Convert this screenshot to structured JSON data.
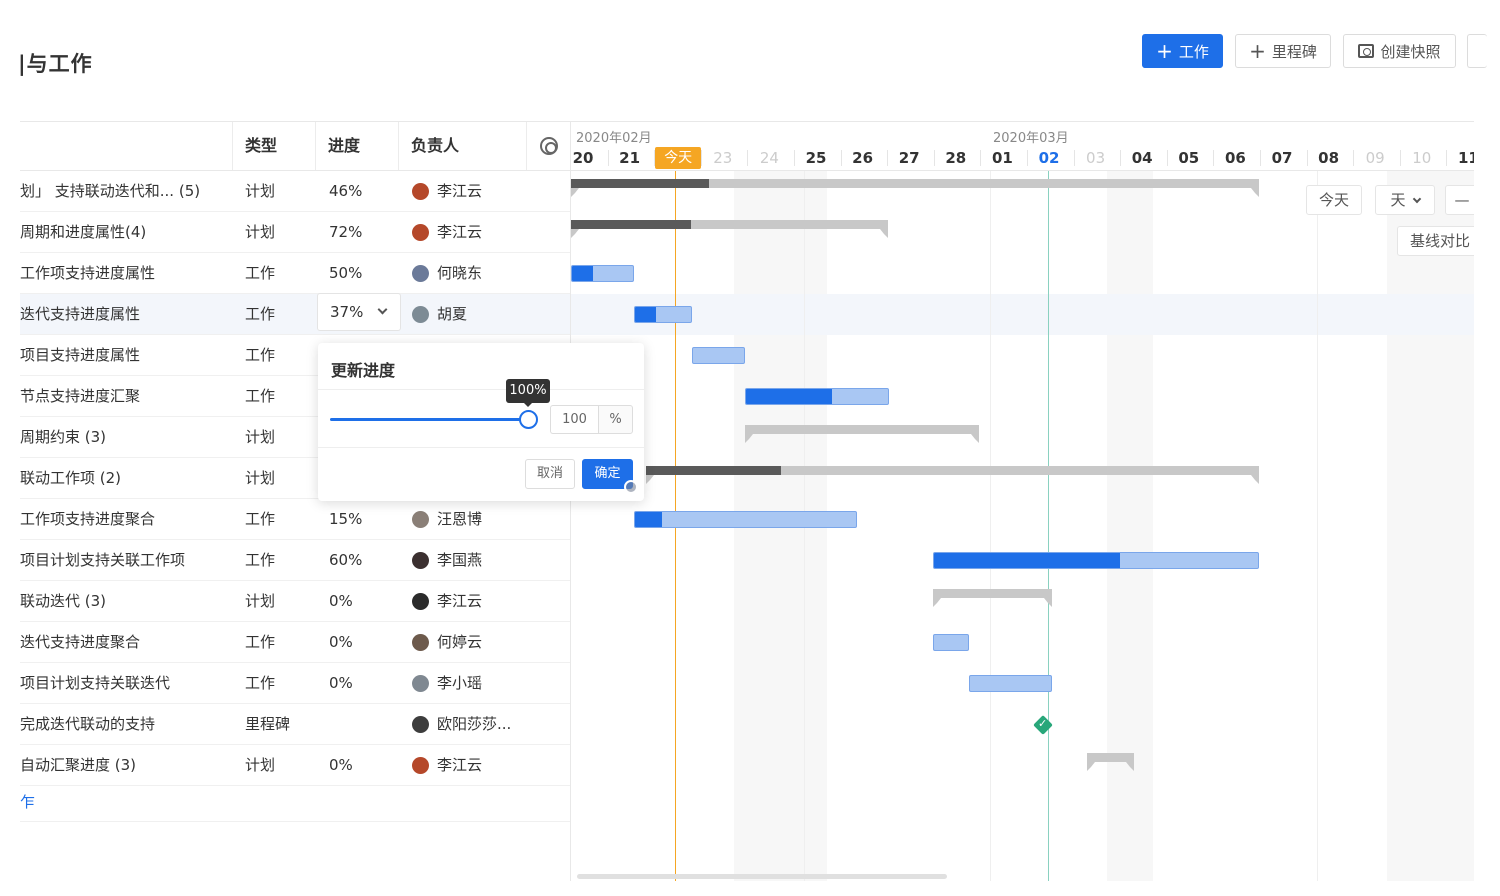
{
  "header": {
    "title": "|与工作",
    "btn_work": "工作",
    "btn_milestone": "里程碑",
    "btn_snapshot": "创建快照"
  },
  "table": {
    "columns": [
      "类型",
      "进度",
      "负责人"
    ],
    "rows": [
      {
        "title": "划」 支持联动迭代和... (5)",
        "type": "计划",
        "progress": "46%",
        "owner": "李江云",
        "avatar": "#b5482a"
      },
      {
        "title": "周期和进度属性(4)",
        "type": "计划",
        "progress": "72%",
        "owner": "李江云",
        "avatar": "#b5482a"
      },
      {
        "title": "工作项支持进度属性",
        "type": "工作",
        "progress": "50%",
        "owner": "何晓东",
        "avatar": "#6b7a99"
      },
      {
        "title": "迭代支持进度属性",
        "type": "工作",
        "progress": "37%",
        "owner": "胡夏",
        "avatar": "#7d8b95"
      },
      {
        "title": "项目支持进度属性",
        "type": "工作",
        "progress": "",
        "owner": "",
        "avatar": ""
      },
      {
        "title": "节点支持进度汇聚",
        "type": "工作",
        "progress": "",
        "owner": "",
        "avatar": ""
      },
      {
        "title": "周期约束 (3)",
        "type": "计划",
        "progress": "",
        "owner": "",
        "avatar": ""
      },
      {
        "title": "联动工作项 (2)",
        "type": "计划",
        "progress": "",
        "owner": "",
        "avatar": ""
      },
      {
        "title": "工作项支持进度聚合",
        "type": "工作",
        "progress": "15%",
        "owner": "汪恩博",
        "avatar": "#8a7f77"
      },
      {
        "title": "项目计划支持关联工作项",
        "type": "工作",
        "progress": "60%",
        "owner": "李国燕",
        "avatar": "#3b3030"
      },
      {
        "title": "联动迭代 (3)",
        "type": "计划",
        "progress": "0%",
        "owner": "李江云",
        "avatar": "#2b2b2b"
      },
      {
        "title": "迭代支持进度聚合",
        "type": "工作",
        "progress": "0%",
        "owner": "何婷云",
        "avatar": "#6d5a4c"
      },
      {
        "title": "项目计划支持关联迭代",
        "type": "工作",
        "progress": "0%",
        "owner": "李小瑶",
        "avatar": "#7f8891"
      },
      {
        "title": "完成迭代联动的支持",
        "type": "里程碑",
        "progress": "",
        "owner": "欧阳莎莎...",
        "avatar": "#3d3d3d"
      },
      {
        "title": "自动汇聚进度 (3)",
        "type": "计划",
        "progress": "0%",
        "owner": "李江云",
        "avatar": "#b5482a"
      }
    ],
    "add_link": "乍"
  },
  "popover": {
    "title": "更新进度",
    "tooltip": "100%",
    "value": "100",
    "unit": "%",
    "cancel": "取消",
    "confirm": "确定",
    "slider_fraction": 1.0
  },
  "gantt": {
    "month1": "2020年02月",
    "month2": "2020年03月",
    "today_label": "今天",
    "days": [
      "20",
      "21",
      "今天",
      "23",
      "24",
      "25",
      "26",
      "27",
      "28",
      "01",
      "02",
      "03",
      "04",
      "05",
      "06",
      "07",
      "08",
      "09",
      "10",
      "11"
    ],
    "weekend_idx": [
      3,
      4,
      11,
      17,
      18
    ],
    "today_day_idx": 10,
    "ctrl_today": "今天",
    "ctrl_unit": "天",
    "ctrl_minus": "—",
    "ctrl_baseline": "基线对比",
    "milestone_check": "✓",
    "colors": {
      "accent": "#1e6fe8",
      "today": "#f5a623",
      "milestone": "#28a77a"
    }
  }
}
